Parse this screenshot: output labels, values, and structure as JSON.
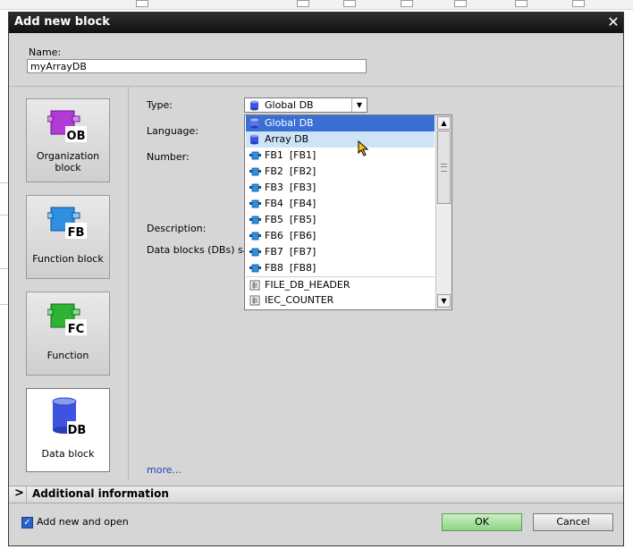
{
  "dialog": {
    "title": "Add new block",
    "close_symbol": "✕",
    "name_label": "Name:",
    "name_value": "myArrayDB"
  },
  "block_types": [
    {
      "label": "Organization block",
      "tag": "OB",
      "color": "#b23bd8"
    },
    {
      "label": "Function block",
      "tag": "FB",
      "color": "#2f8fe0"
    },
    {
      "label": "Function",
      "tag": "FC",
      "color": "#2db234"
    },
    {
      "label": "Data block",
      "tag": "DB",
      "color": "#3c54e0",
      "selected": true
    }
  ],
  "fields": {
    "type_label": "Type:",
    "language_label": "Language:",
    "number_label": "Number:",
    "description_label": "Description:",
    "dbs_label": "Data blocks (DBs) sa"
  },
  "type_select": {
    "value": "Global DB",
    "options": [
      {
        "text": "Global DB",
        "icon": "db-icon",
        "state": "selected"
      },
      {
        "text": "Array DB",
        "icon": "db-icon",
        "state": "hover"
      },
      {
        "text": "FB1  [FB1]",
        "icon": "fb-icon"
      },
      {
        "text": "FB2  [FB2]",
        "icon": "fb-icon"
      },
      {
        "text": "FB3  [FB3]",
        "icon": "fb-icon"
      },
      {
        "text": "FB4  [FB4]",
        "icon": "fb-icon"
      },
      {
        "text": "FB5  [FB5]",
        "icon": "fb-icon"
      },
      {
        "text": "FB6  [FB6]",
        "icon": "fb-icon"
      },
      {
        "text": "FB7  [FB7]",
        "icon": "fb-icon"
      },
      {
        "text": "FB8  [FB8]",
        "icon": "fb-icon"
      },
      {
        "text": "FILE_DB_HEADER",
        "icon": "udt-icon"
      },
      {
        "text": "IEC_COUNTER",
        "icon": "udt-icon"
      }
    ]
  },
  "more_link": "more...",
  "additional_info": {
    "chevron": ">",
    "label": "Additional information"
  },
  "footer": {
    "checkbox_label": "Add new and open",
    "checkbox_checked": true,
    "ok_label": "OK",
    "cancel_label": "Cancel"
  }
}
